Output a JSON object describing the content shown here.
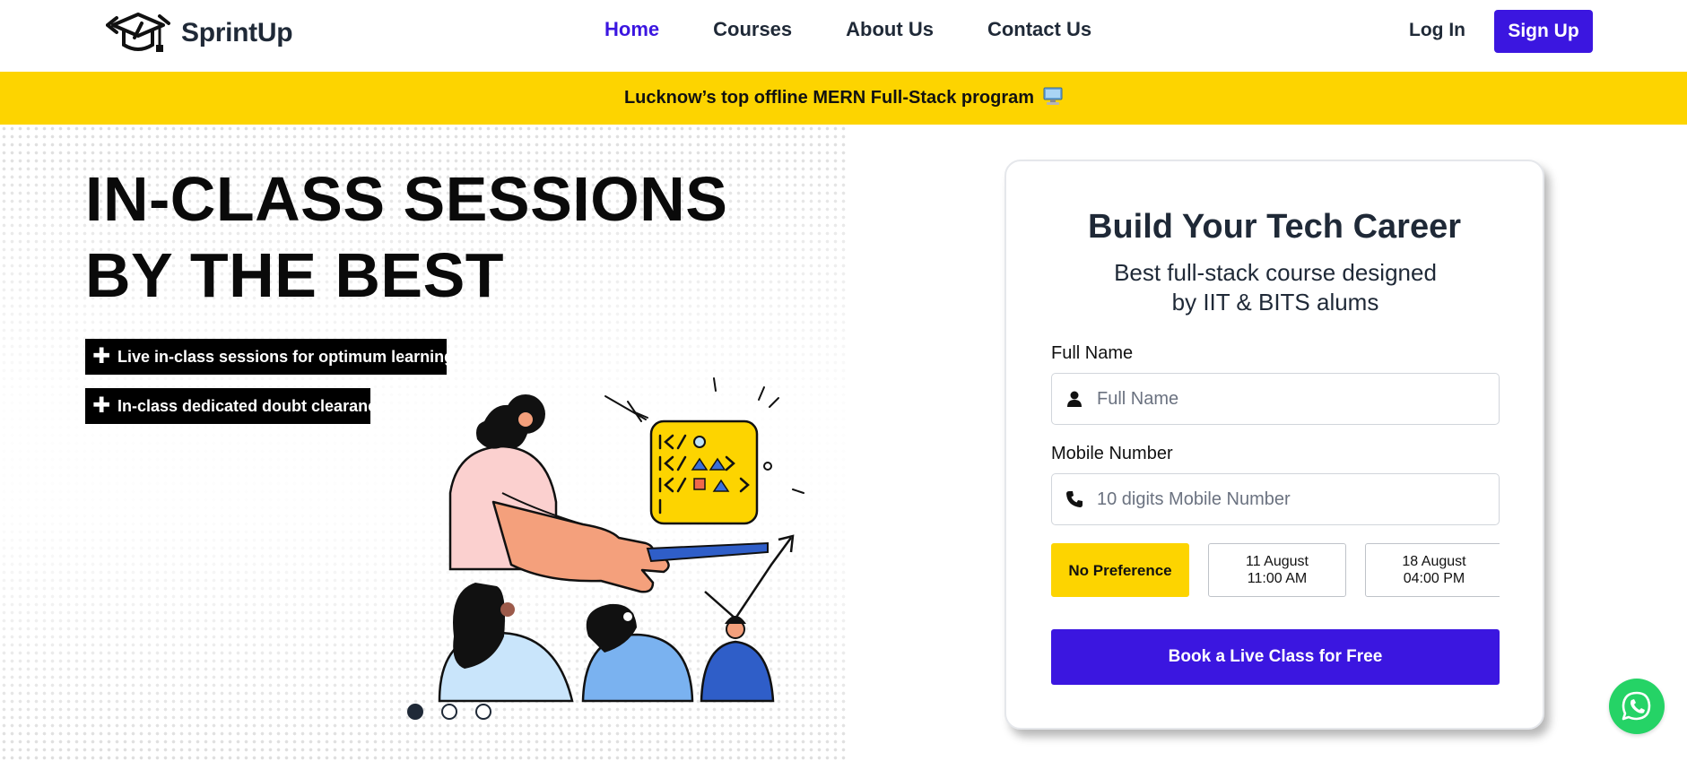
{
  "brand": {
    "name": "SprintUp",
    "logo_icon": "graduation-code-icon"
  },
  "nav": {
    "items": [
      {
        "label": "Home",
        "active": true
      },
      {
        "label": "Courses",
        "active": false
      },
      {
        "label": "About Us",
        "active": false
      },
      {
        "label": "Contact Us",
        "active": false
      }
    ],
    "login_label": "Log In",
    "signup_label": "Sign Up"
  },
  "banner": {
    "text": "Lucknow’s top offline MERN Full-Stack program",
    "icon": "computer-icon"
  },
  "hero": {
    "title_line1": "IN-CLASS SESSIONS",
    "title_line2": "BY THE BEST",
    "tags": [
      "Live in-class sessions for optimum learning",
      "In-class dedicated doubt clearance"
    ],
    "carousel": {
      "count": 3,
      "active_index": 0
    },
    "illustration": "classroom-teacher-illustration"
  },
  "form": {
    "title": "Build Your Tech Career",
    "subtitle_line1": "Best full-stack course designed",
    "subtitle_line2": "by IIT & BITS alums",
    "name_label": "Full Name",
    "name_placeholder": "Full Name",
    "name_value": "",
    "mobile_label": "Mobile Number",
    "mobile_placeholder": "10 digits Mobile Number",
    "mobile_value": "",
    "slots": [
      {
        "line1": "No Preference",
        "line2": "",
        "selected": true
      },
      {
        "line1": "11 August",
        "line2": "11:00 AM",
        "selected": false
      },
      {
        "line1": "18 August",
        "line2": "04:00 PM",
        "selected": false
      }
    ],
    "submit_label": "Book a Live Class for Free"
  },
  "floating": {
    "whatsapp_icon": "whatsapp-icon"
  },
  "colors": {
    "primary": "#3b16e0",
    "accent": "#fdd400",
    "text": "#1f2937",
    "whatsapp": "#25d366"
  }
}
